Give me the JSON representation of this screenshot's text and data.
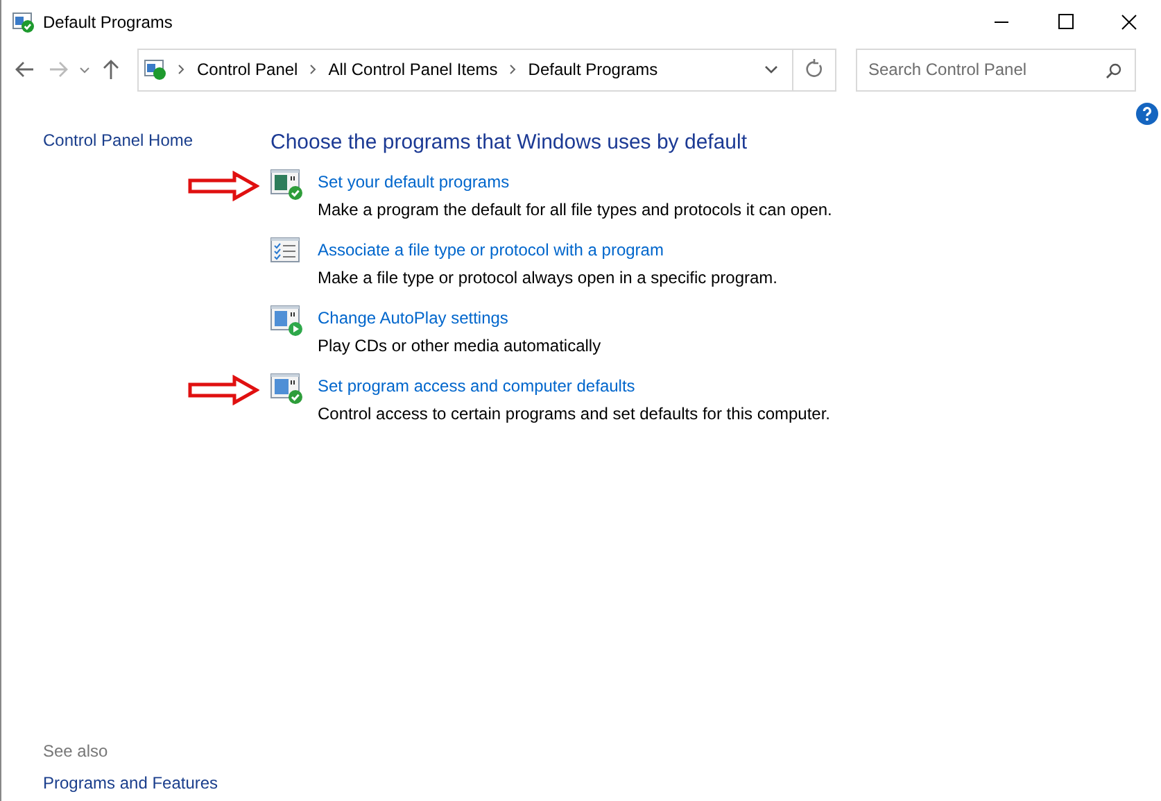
{
  "window": {
    "title": "Default Programs"
  },
  "breadcrumb": [
    "Control Panel",
    "All Control Panel Items",
    "Default Programs"
  ],
  "search": {
    "placeholder": "Search Control Panel"
  },
  "sidebar": {
    "home": "Control Panel Home",
    "see_also": "See also",
    "links": [
      "Programs and Features"
    ]
  },
  "heading": "Choose the programs that Windows uses by default",
  "items": [
    {
      "kind": "check",
      "title": "Set your default programs",
      "description": "Make a program the default for all file types and protocols it can open.",
      "arrow": true
    },
    {
      "kind": "list",
      "title": "Associate a file type or protocol with a program",
      "description": "Make a file type or protocol always open in a specific program.",
      "arrow": false
    },
    {
      "kind": "play",
      "title": "Change AutoPlay settings",
      "description": "Play CDs or other media automatically",
      "arrow": false
    },
    {
      "kind": "access",
      "title": "Set program access and computer defaults",
      "description": "Control access to certain programs and set defaults for this computer.",
      "arrow": true
    }
  ]
}
